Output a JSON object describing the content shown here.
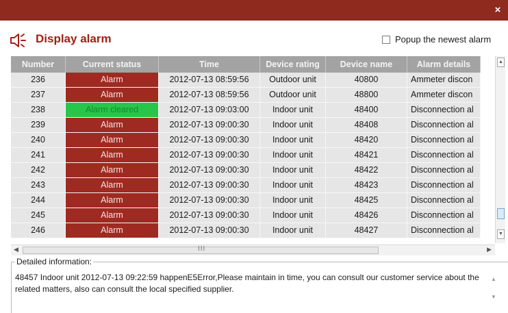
{
  "dialog": {
    "close_label": "×"
  },
  "header": {
    "title": "Display alarm",
    "popup_newest_label": "Popup the newest alarm",
    "popup_newest_checked": false
  },
  "table": {
    "columns": [
      "Number",
      "Current status",
      "Time",
      "Device rating",
      "Device name",
      "Alarm details"
    ],
    "rows": [
      {
        "number": "236",
        "status": "Alarm",
        "status_type": "alarm",
        "time": "2012-07-13 08:59:56",
        "rating": "Outdoor unit",
        "device": "40800",
        "details": "Ammeter discon"
      },
      {
        "number": "237",
        "status": "Alarm",
        "status_type": "alarm",
        "time": "2012-07-13 08:59:56",
        "rating": "Outdoor unit",
        "device": "48800",
        "details": "Ammeter discon"
      },
      {
        "number": "238",
        "status": "Alarm cleared",
        "status_type": "cleared",
        "time": "2012-07-13 09:03:00",
        "rating": "Indoor unit",
        "device": "48400",
        "details": "Disconnection al"
      },
      {
        "number": "239",
        "status": "Alarm",
        "status_type": "alarm",
        "time": "2012-07-13 09:00:30",
        "rating": "Indoor unit",
        "device": "48408",
        "details": "Disconnection al"
      },
      {
        "number": "240",
        "status": "Alarm",
        "status_type": "alarm",
        "time": "2012-07-13 09:00:30",
        "rating": "Indoor unit",
        "device": "48420",
        "details": "Disconnection al"
      },
      {
        "number": "241",
        "status": "Alarm",
        "status_type": "alarm",
        "time": "2012-07-13 09:00:30",
        "rating": "Indoor unit",
        "device": "48421",
        "details": "Disconnection al"
      },
      {
        "number": "242",
        "status": "Alarm",
        "status_type": "alarm",
        "time": "2012-07-13 09:00:30",
        "rating": "Indoor unit",
        "device": "48422",
        "details": "Disconnection al"
      },
      {
        "number": "243",
        "status": "Alarm",
        "status_type": "alarm",
        "time": "2012-07-13 09:00:30",
        "rating": "Indoor unit",
        "device": "48423",
        "details": "Disconnection al"
      },
      {
        "number": "244",
        "status": "Alarm",
        "status_type": "alarm",
        "time": "2012-07-13 09:00:30",
        "rating": "Indoor unit",
        "device": "48425",
        "details": "Disconnection al"
      },
      {
        "number": "245",
        "status": "Alarm",
        "status_type": "alarm",
        "time": "2012-07-13 09:00:30",
        "rating": "Indoor unit",
        "device": "48426",
        "details": "Disconnection al"
      },
      {
        "number": "246",
        "status": "Alarm",
        "status_type": "alarm",
        "time": "2012-07-13 09:00:30",
        "rating": "Indoor unit",
        "device": "48427",
        "details": "Disconnection al"
      }
    ]
  },
  "scrollbar": {
    "grip": "III"
  },
  "detail": {
    "legend": "Detailed information:",
    "text": "48457 Indoor unit 2012-07-13 09:22:59 happenE5Error,Please maintain in time, you can consult our customer service about the related matters, also can consult the local specified supplier."
  },
  "colors": {
    "titlebar": "#8f2a1f",
    "title_text": "#a11f16",
    "alarm_cell": "#9e2a22",
    "cleared_cell": "#27c64a",
    "header_cell": "#a3a3a3",
    "row_cell": "#e6e6e6"
  },
  "icons": {
    "close": "close-icon",
    "speaker": "speaker-alarm-icon",
    "scroll_up": "chevron-up-icon",
    "scroll_down": "chevron-down-icon",
    "scroll_left": "chevron-left-icon",
    "scroll_right": "chevron-right-icon"
  }
}
